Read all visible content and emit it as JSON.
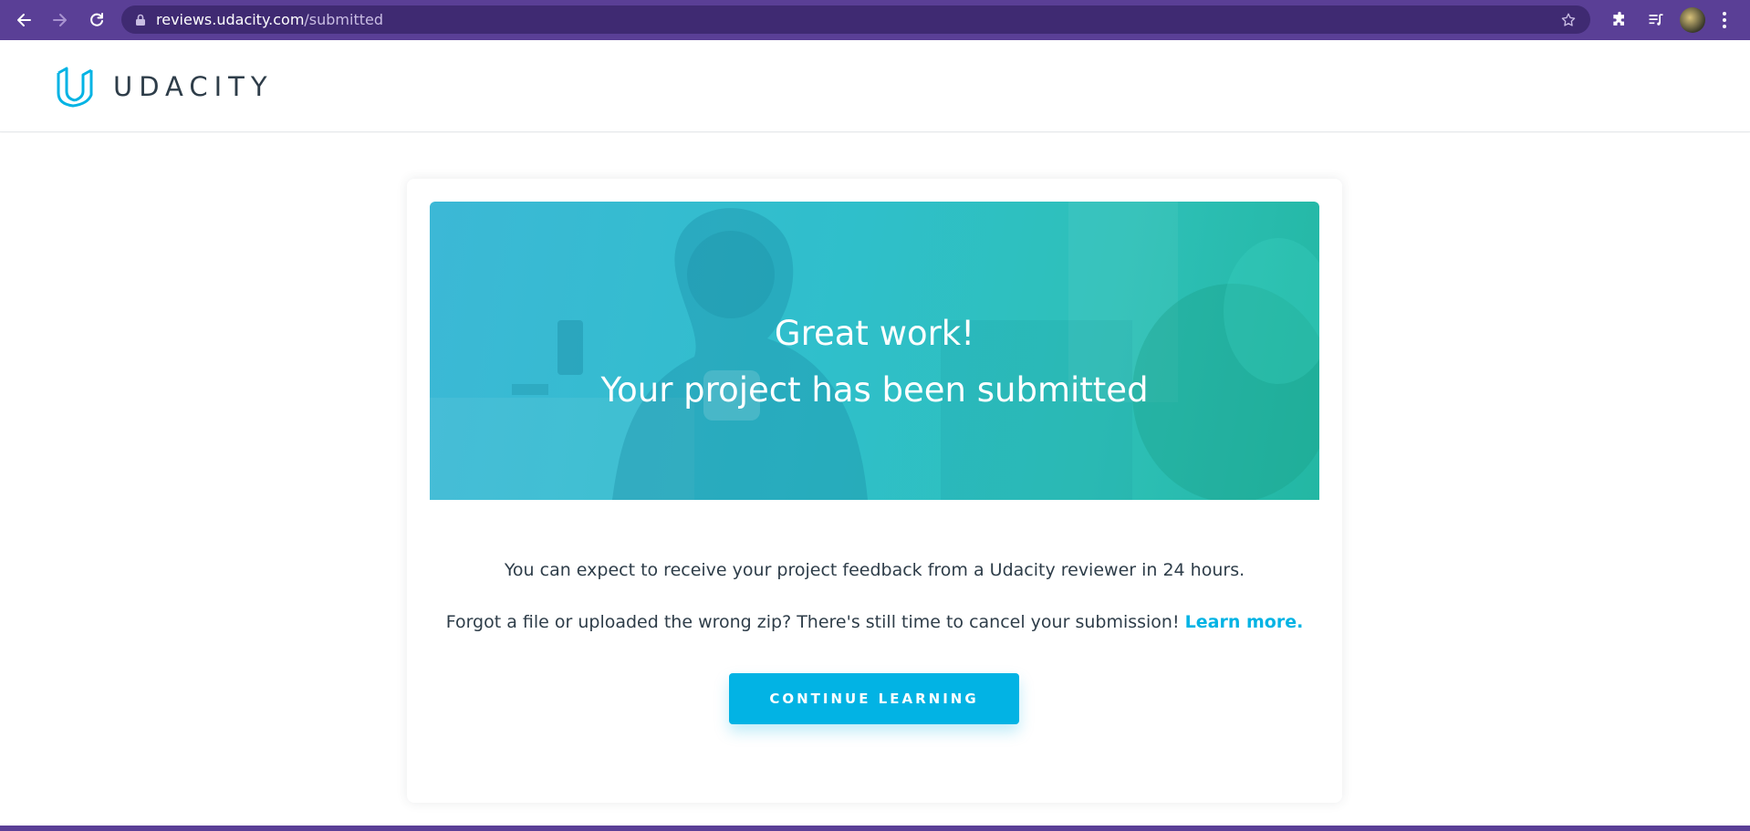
{
  "browser": {
    "url_host": "reviews.udacity.com",
    "url_path": "/submitted",
    "icons": [
      "back-arrow-icon",
      "forward-arrow-icon",
      "reload-icon",
      "lock-icon",
      "bookmark-star-icon",
      "extensions-puzzle-icon",
      "reading-list-icon",
      "profile-avatar",
      "more-menu-icon"
    ]
  },
  "header": {
    "brand": "UDACITY"
  },
  "hero": {
    "title": "Great work!",
    "subtitle": "Your project has been submitted"
  },
  "main": {
    "message_1": "You can expect to receive your project feedback from a Udacity reviewer in 24 hours.",
    "message_2": "Forgot a file or uploaded the wrong zip? There's still time to cancel your submission!",
    "learn_more": "Learn more.",
    "cta_label": "CONTINUE LEARNING"
  },
  "colors": {
    "chrome": "#5a3f96",
    "accent": "#02b3e4",
    "text": "#2e3d49",
    "hero_teal": "#2ec0b8"
  }
}
